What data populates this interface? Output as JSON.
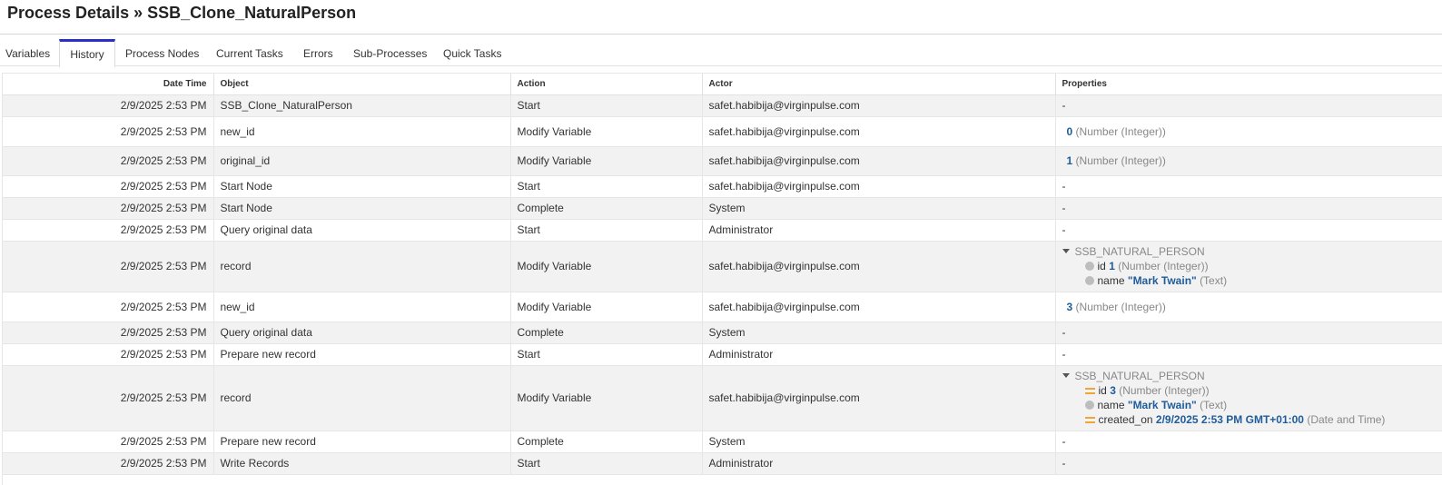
{
  "header": {
    "title": "Process Details » SSB_Clone_NaturalPerson"
  },
  "tabs": [
    {
      "label": "Variables"
    },
    {
      "label": "History",
      "active": true
    },
    {
      "label": "Process Nodes"
    },
    {
      "label": "Current Tasks"
    },
    {
      "label": "Errors"
    },
    {
      "label": "Sub-Processes"
    },
    {
      "label": "Quick Tasks"
    }
  ],
  "colors": {
    "active_tab_accent": "#2d2dc8",
    "value_blue": "#1f5c99",
    "change_icon": "#f0a43a",
    "stripe": "#f2f2f2"
  },
  "table": {
    "columns": [
      "Date Time",
      "Object",
      "Action",
      "Actor",
      "Properties"
    ],
    "rows": [
      {
        "datetime": "2/9/2025 2:53 PM",
        "object": "SSB_Clone_NaturalPerson",
        "action": "Start",
        "actor": "safet.habibija@virginpulse.com",
        "properties": "-"
      },
      {
        "datetime": "2/9/2025 2:53 PM",
        "object": "new_id",
        "action": "Modify Variable",
        "actor": "safet.habibija@virginpulse.com",
        "prop_value": "0",
        "prop_type": "(Number (Integer))"
      },
      {
        "datetime": "2/9/2025 2:53 PM",
        "object": "original_id",
        "action": "Modify Variable",
        "actor": "safet.habibija@virginpulse.com",
        "prop_value": "1",
        "prop_type": "(Number (Integer))"
      },
      {
        "datetime": "2/9/2025 2:53 PM",
        "object": "Start Node",
        "action": "Start",
        "actor": "safet.habibija@virginpulse.com",
        "properties": "-"
      },
      {
        "datetime": "2/9/2025 2:53 PM",
        "object": "Start Node",
        "action": "Complete",
        "actor": "System",
        "properties": "-"
      },
      {
        "datetime": "2/9/2025 2:53 PM",
        "object": "Query original data",
        "action": "Start",
        "actor": "Administrator",
        "properties": "-"
      },
      {
        "datetime": "2/9/2025 2:53 PM",
        "object": "record",
        "action": "Modify Variable",
        "actor": "safet.habibija@virginpulse.com",
        "tree": {
          "root": "SSB_NATURAL_PERSON",
          "fields": [
            {
              "key": "id",
              "value": "1",
              "type": "(Number (Integer))",
              "icon": "unchanged-dot-icon"
            },
            {
              "key": "name",
              "value": "\"Mark Twain\"",
              "type": "(Text)",
              "icon": "unchanged-dot-icon"
            }
          ]
        }
      },
      {
        "datetime": "2/9/2025 2:53 PM",
        "object": "new_id",
        "action": "Modify Variable",
        "actor": "safet.habibija@virginpulse.com",
        "prop_value": "3",
        "prop_type": "(Number (Integer))"
      },
      {
        "datetime": "2/9/2025 2:53 PM",
        "object": "Query original data",
        "action": "Complete",
        "actor": "System",
        "properties": "-"
      },
      {
        "datetime": "2/9/2025 2:53 PM",
        "object": "Prepare new record",
        "action": "Start",
        "actor": "Administrator",
        "properties": "-"
      },
      {
        "datetime": "2/9/2025 2:53 PM",
        "object": "record",
        "action": "Modify Variable",
        "actor": "safet.habibija@virginpulse.com",
        "tree": {
          "root": "SSB_NATURAL_PERSON",
          "fields": [
            {
              "key": "id",
              "value": "3",
              "type": "(Number (Integer))",
              "icon": "changed-icon"
            },
            {
              "key": "name",
              "value": "\"Mark Twain\"",
              "type": "(Text)",
              "icon": "unchanged-dot-icon"
            },
            {
              "key": "created_on",
              "value": "2/9/2025 2:53 PM GMT+01:00",
              "type": "(Date and Time)",
              "icon": "changed-icon"
            }
          ]
        }
      },
      {
        "datetime": "2/9/2025 2:53 PM",
        "object": "Prepare new record",
        "action": "Complete",
        "actor": "System",
        "properties": "-"
      },
      {
        "datetime": "2/9/2025 2:53 PM",
        "object": "Write Records",
        "action": "Start",
        "actor": "Administrator",
        "properties": "-"
      }
    ]
  }
}
